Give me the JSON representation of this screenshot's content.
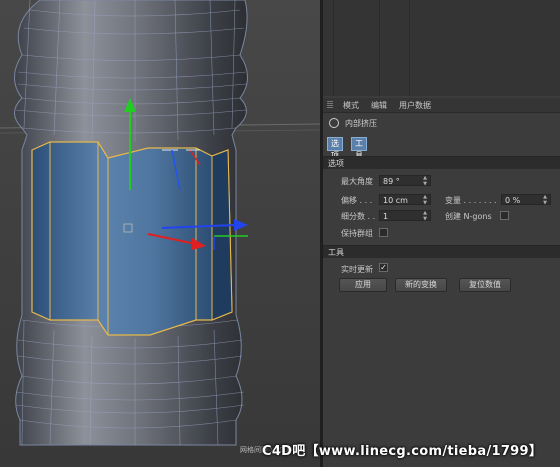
{
  "menu": {
    "mode": "模式",
    "edit": "编辑",
    "user_data": "用户数据"
  },
  "object": {
    "title": "内部挤压"
  },
  "tabs": [
    {
      "label": "选项"
    },
    {
      "label": "工具"
    }
  ],
  "options": {
    "section": "选项",
    "max_angle_label": "最大角度",
    "max_angle_value": "89 °",
    "offset_label": "偏移 . . .",
    "offset_value": "10 cm",
    "variance_label": "变量 . . . . . . .",
    "variance_value": "0 %",
    "subdivision_label": "细分数 . .",
    "subdivision_value": "1",
    "create_ngons_label": "创建 N-gons",
    "preserve_groups_label": "保持群组"
  },
  "tool": {
    "section": "工具",
    "realtime_label": "实时更新",
    "apply_label": "应用",
    "new_transform_label": "新的变换",
    "reset_label": "复位数值"
  },
  "viewport": {
    "label": "网格间距 : 1000 cm"
  },
  "watermark": "C4D吧【www.linecg.com/tieba/1799】",
  "colors": {
    "selection": "#3d6a9c",
    "accent_tab": "#5a7fa8",
    "edge_highlight": "#e8b84a"
  },
  "icons": [
    "move-y-arrow-icon",
    "move-x-arrow-icon",
    "move-z-arrow-icon",
    "object-tool-icon",
    "checkmark-icon"
  ]
}
